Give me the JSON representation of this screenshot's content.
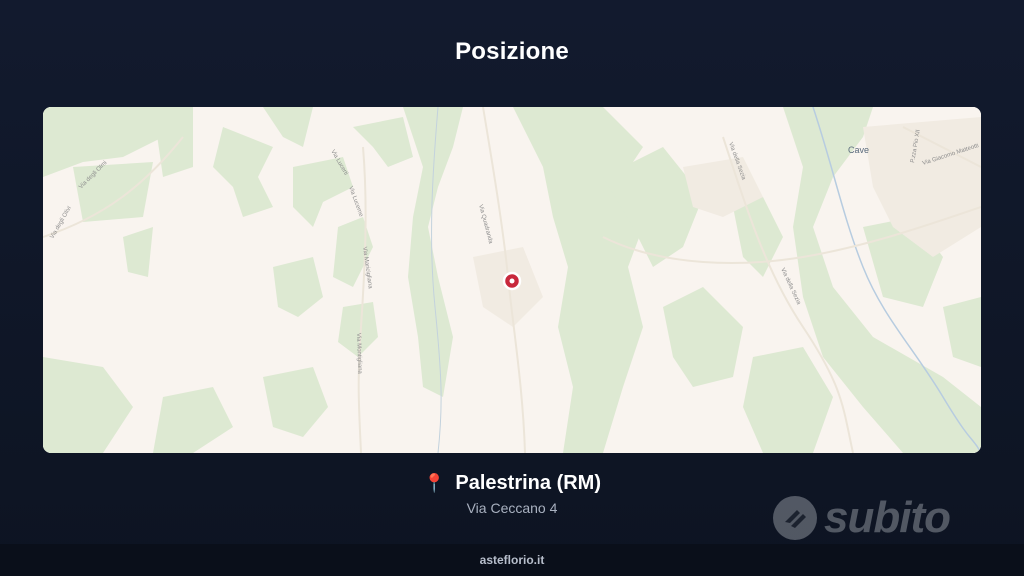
{
  "header": {
    "title": "Posizione"
  },
  "map": {
    "town_label": "Cave",
    "street_labels": [
      "Via degli Olivi",
      "Via degli Olmi",
      "Via Lucerti",
      "Via Lucerne",
      "Via Maricigliana",
      "Via Montigliana",
      "Via Quadranda",
      "Via della Sezia",
      "Via della Sezia",
      "P.zza Pio XII",
      "Via Giacomo Matteotti"
    ]
  },
  "location": {
    "pin_icon": "round-pushpin-icon",
    "city": "Palestrina (RM)",
    "address": "Via Ceccano 4"
  },
  "footer": {
    "site": "asteflorio.it"
  },
  "watermark": {
    "brand": "subito"
  },
  "colors": {
    "background": "#121a2e",
    "map_base": "#f9f4ef",
    "map_green": "#dcebd3",
    "marker": "#c8283c"
  }
}
